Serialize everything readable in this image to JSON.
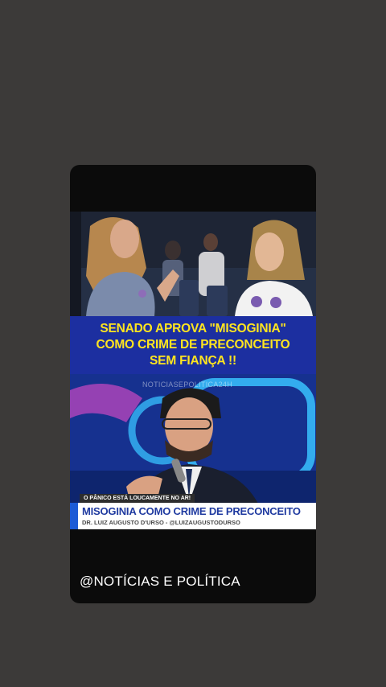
{
  "headline": {
    "line1": "SENADO APROVA \"MISOGINIA\"",
    "line2": "COMO CRIME DE PRECONCEITO",
    "line3": "SEM FIANÇA !!"
  },
  "video": {
    "watermark": "NOTICIASEPOLITICA24H",
    "ticker": "O PÂNICO ESTÁ LOUCAMENTE NO AR!",
    "title": "MISOGINIA COMO CRIME DE PRECONCEITO",
    "subtitle": "DR. LUIZ AUGUSTO D'URSO - @LUIZAUGUSTODURSO"
  },
  "footer": {
    "handle": "@NOTÍCIAS E POLÍTICA"
  },
  "colors": {
    "background": "#3c3a39",
    "headline_bg": "#1c2fa0",
    "headline_text": "#ffe51f",
    "lower_third_title": "#1f3aa0"
  }
}
